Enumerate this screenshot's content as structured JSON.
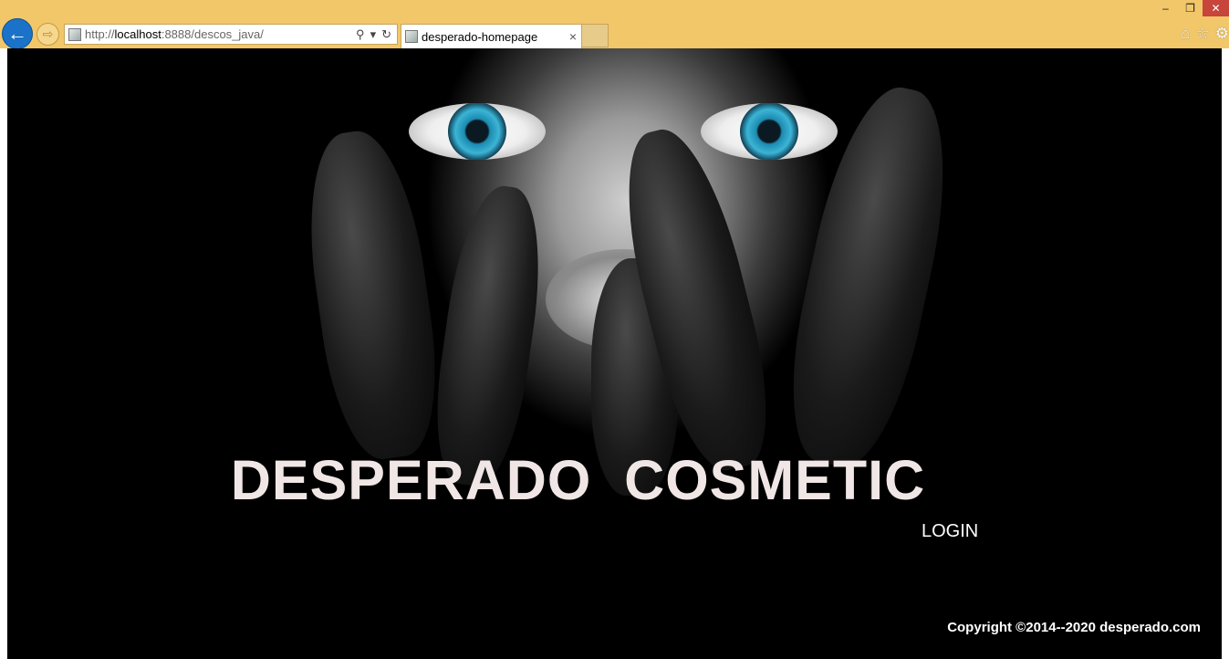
{
  "browser": {
    "address": {
      "scheme": "http://",
      "host": "localhost",
      "rest": ":8888/descos_java/"
    },
    "tab": {
      "title": "desperado-homepage",
      "close": "×"
    },
    "window": {
      "minimize": "–",
      "restore": "❐",
      "close": "✕"
    },
    "icons": {
      "back": "back-arrow-icon",
      "forward": "forward-arrow-icon",
      "search": "search-icon",
      "refresh": "refresh-icon",
      "home": "home-icon",
      "favorites": "star-icon",
      "settings": "gear-icon"
    },
    "colors": {
      "chrome": "#f1c76a",
      "back_button": "#1a73c8",
      "close_button": "#c7453b"
    }
  },
  "page": {
    "title": "DESPERADO  COSMETIC",
    "login": "LOGIN",
    "copyright": "Copyright ©2014--2020 desperado.com"
  }
}
